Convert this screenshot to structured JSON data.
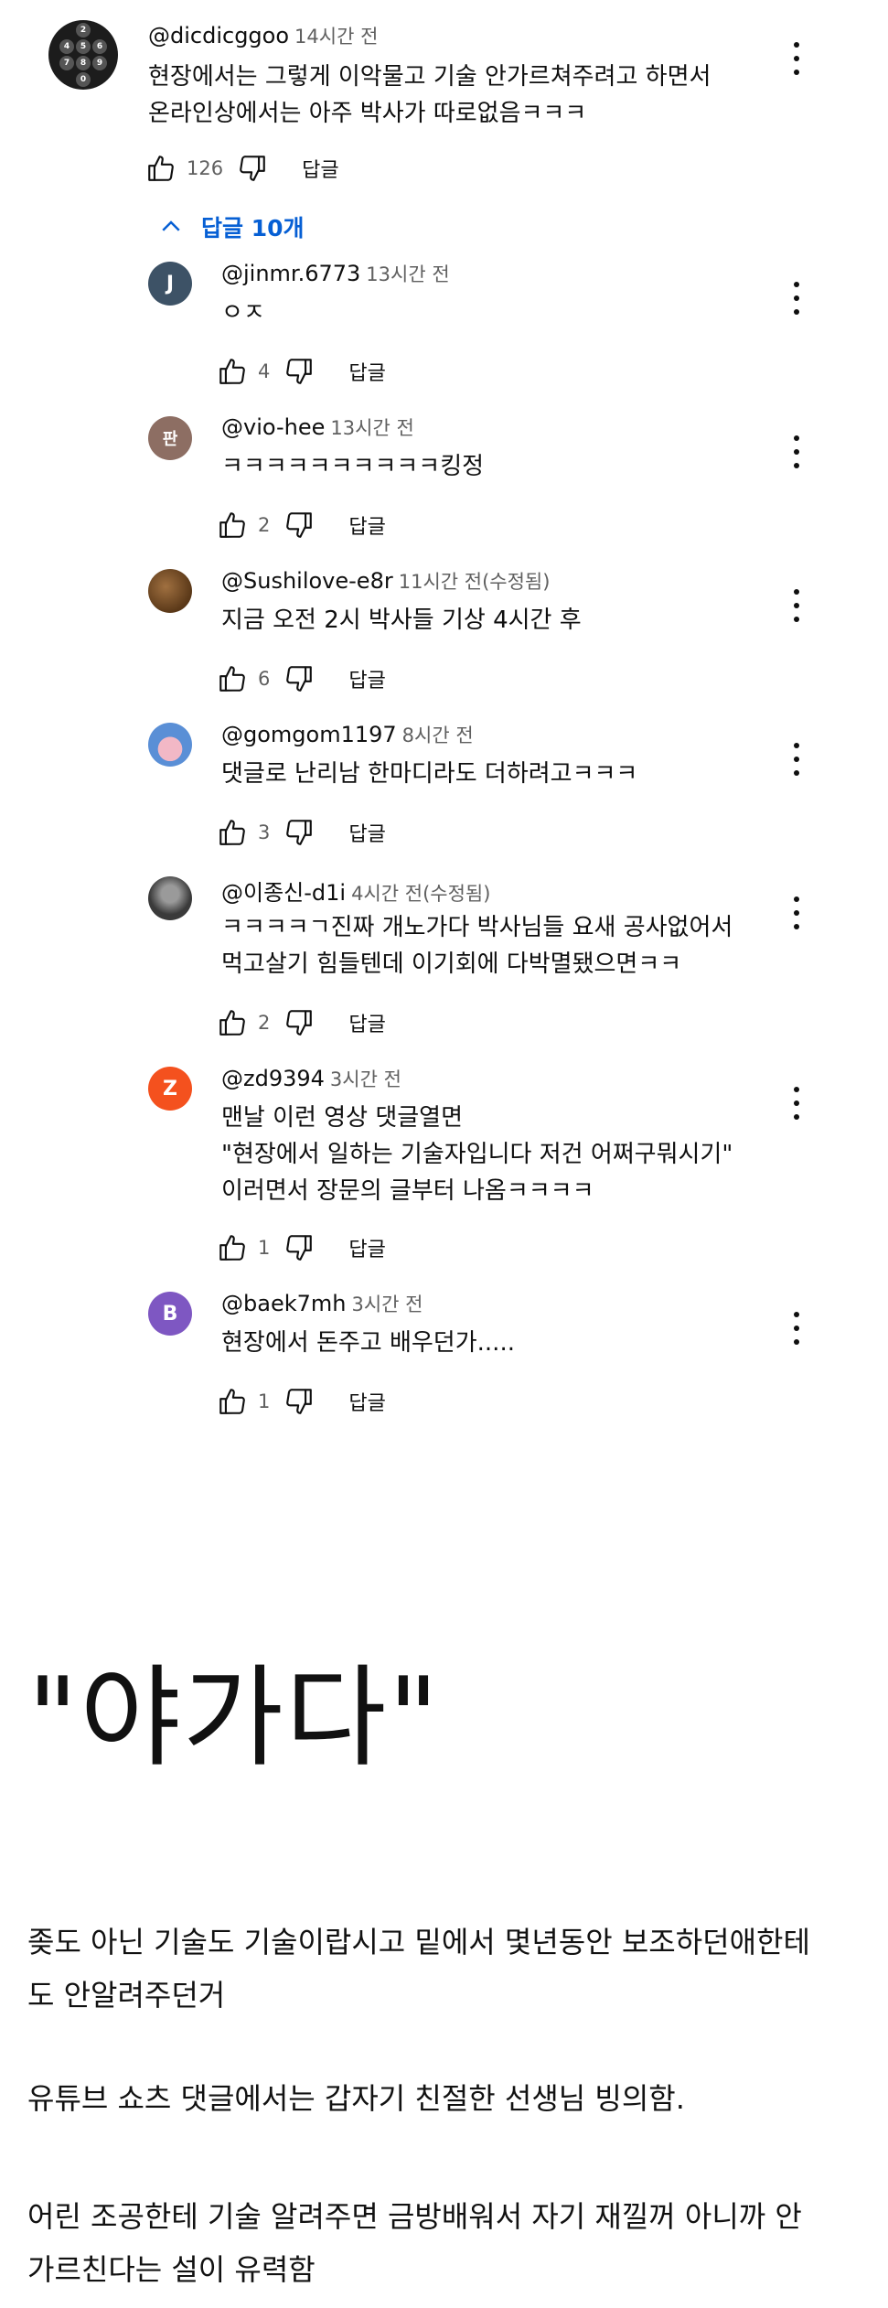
{
  "top_comment": {
    "author": "@dicdicggoo",
    "time": "14시간 전",
    "lines": [
      "현장에서는 그렇게 이악물고 기술 안가르쳐주려고 하면서",
      "온라인상에서는 아주 박사가 따로없음ㅋㅋㅋ"
    ],
    "likes": "126",
    "reply_label": "답글",
    "avatar_keys": [
      "",
      "2",
      "",
      "4",
      "5",
      "6",
      "7",
      "8",
      "9",
      "",
      "0",
      ""
    ]
  },
  "replies_toggle": {
    "label": "답글 10개"
  },
  "replies": [
    {
      "author": "@jinmr.6773",
      "time": "13시간 전",
      "lines": [
        "ㅇㅈ"
      ],
      "likes": "4",
      "reply_label": "답글",
      "avatar_letter": "J",
      "avatar_color": "#3d5266"
    },
    {
      "author": "@vio-hee",
      "time": "13시간 전",
      "lines": [
        "ㅋㅋㅋㅋㅋㅋㅋㅋㅋㅋ킹정"
      ],
      "likes": "2",
      "reply_label": "답글",
      "avatar_letter": "판",
      "avatar_color": "#8d6e63"
    },
    {
      "author": "@Sushilove-e8r",
      "time": "11시간 전(수정됨)",
      "lines": [
        "지금 오전 2시 박사들 기상 4시간 후"
      ],
      "likes": "6",
      "reply_label": "답글",
      "avatar_letter": "",
      "avatar_color": "#6b4a2b"
    },
    {
      "author": "@gomgom1197",
      "time": "8시간 전",
      "lines": [
        "댓글로 난리남 한마디라도 더하려고ㅋㅋㅋ"
      ],
      "likes": "3",
      "reply_label": "답글",
      "avatar_letter": "",
      "avatar_color": "#5a8fd6"
    },
    {
      "author": "@이종신-d1i",
      "time": "4시간 전(수정됨)",
      "lines": [
        "ㅋㅋㅋㅋㄱ진짜 개노가다 박사님들 요새 공사없어서",
        "먹고살기 힘들텐데 이기회에 다박멸됐으면ㅋㅋ"
      ],
      "likes": "2",
      "reply_label": "답글",
      "avatar_letter": "",
      "avatar_color": "#4a4a4a"
    },
    {
      "author": "@zd9394",
      "time": "3시간 전",
      "lines": [
        "맨날 이런 영상 댓글열면",
        "\"현장에서 일하는 기술자입니다 저건 어쩌구뭐시기\"",
        "이러면서 장문의 글부터 나옴ㅋㅋㅋㅋ"
      ],
      "likes": "1",
      "reply_label": "답글",
      "avatar_letter": "Z",
      "avatar_color": "#f4511e"
    },
    {
      "author": "@baek7mh",
      "time": "3시간 전",
      "lines": [
        "현장에서 돈주고 배우던가....."
      ],
      "likes": "1",
      "reply_label": "답글",
      "avatar_letter": "B",
      "avatar_color": "#7e57c2"
    }
  ],
  "article": {
    "title": "\"야가다\"",
    "paragraphs": [
      [
        "좆도 아닌 기술도 기술이랍시고 밑에서 몇년동안 보조하던애한테",
        "도 안알려주던거"
      ],
      [
        "유튜브 쇼츠 댓글에서는 갑자기 친절한 선생님 빙의함."
      ],
      [
        "어린 조공한테 기술 알려주면 금방배워서 자기 재낄꺼 아니까 안",
        "가르친다는 설이 유력함"
      ]
    ]
  },
  "icons": {
    "like": "thumb-up-icon",
    "dislike": "thumb-down-icon",
    "more": "more-vert-icon",
    "collapse": "chevron-up-icon"
  },
  "colors": {
    "link_blue": "#065fd4",
    "meta_gray": "#606060"
  }
}
